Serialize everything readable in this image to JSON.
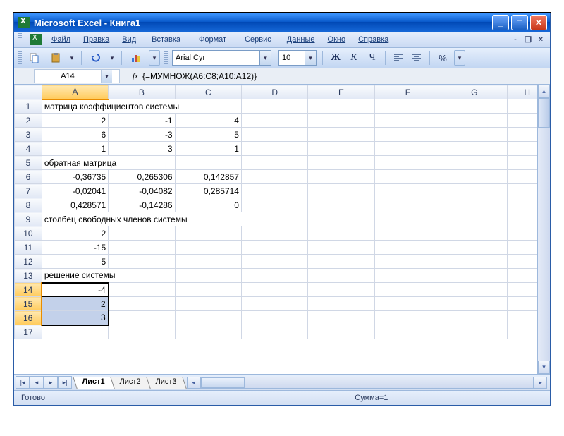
{
  "title": "Microsoft Excel - Книга1",
  "menus": {
    "file": "Файл",
    "edit": "Правка",
    "view": "Вид",
    "insert": "Вставка",
    "format": "Формат",
    "tools": "Сервис",
    "data": "Данные",
    "window": "Окно",
    "help": "Справка"
  },
  "font": {
    "name": "Arial Cyr",
    "size": "10"
  },
  "bold": "Ж",
  "italic": "К",
  "underline": "Ч",
  "percent": "%",
  "namebox": "A14",
  "fx": "fx",
  "formula": "{=МУМНОЖ(A6:C8;A10:A12)}",
  "cols": [
    "A",
    "B",
    "C",
    "D",
    "E",
    "F",
    "G",
    "H"
  ],
  "rows": [
    "1",
    "2",
    "3",
    "4",
    "5",
    "6",
    "7",
    "8",
    "9",
    "10",
    "11",
    "12",
    "13",
    "14",
    "15",
    "16",
    "17"
  ],
  "cells": {
    "r1": {
      "A": "матрица коэффициентов системы"
    },
    "r2": {
      "A": "2",
      "B": "-1",
      "C": "4"
    },
    "r3": {
      "A": "6",
      "B": "-3",
      "C": "5"
    },
    "r4": {
      "A": "1",
      "B": "3",
      "C": "1"
    },
    "r5": {
      "A": "обратная матрица"
    },
    "r6": {
      "A": "-0,36735",
      "B": "0,265306",
      "C": "0,142857"
    },
    "r7": {
      "A": "-0,02041",
      "B": "-0,04082",
      "C": "0,285714"
    },
    "r8": {
      "A": "0,428571",
      "B": "-0,14286",
      "C": "0"
    },
    "r9": {
      "A": "столбец свободных членов системы"
    },
    "r10": {
      "A": "2"
    },
    "r11": {
      "A": "-15"
    },
    "r12": {
      "A": "5"
    },
    "r13": {
      "A": "решение системы"
    },
    "r14": {
      "A": "-4"
    },
    "r15": {
      "A": "2"
    },
    "r16": {
      "A": "3"
    }
  },
  "tabs": {
    "s1": "Лист1",
    "s2": "Лист2",
    "s3": "Лист3"
  },
  "status": {
    "ready": "Готово",
    "sum": "Сумма=1"
  }
}
